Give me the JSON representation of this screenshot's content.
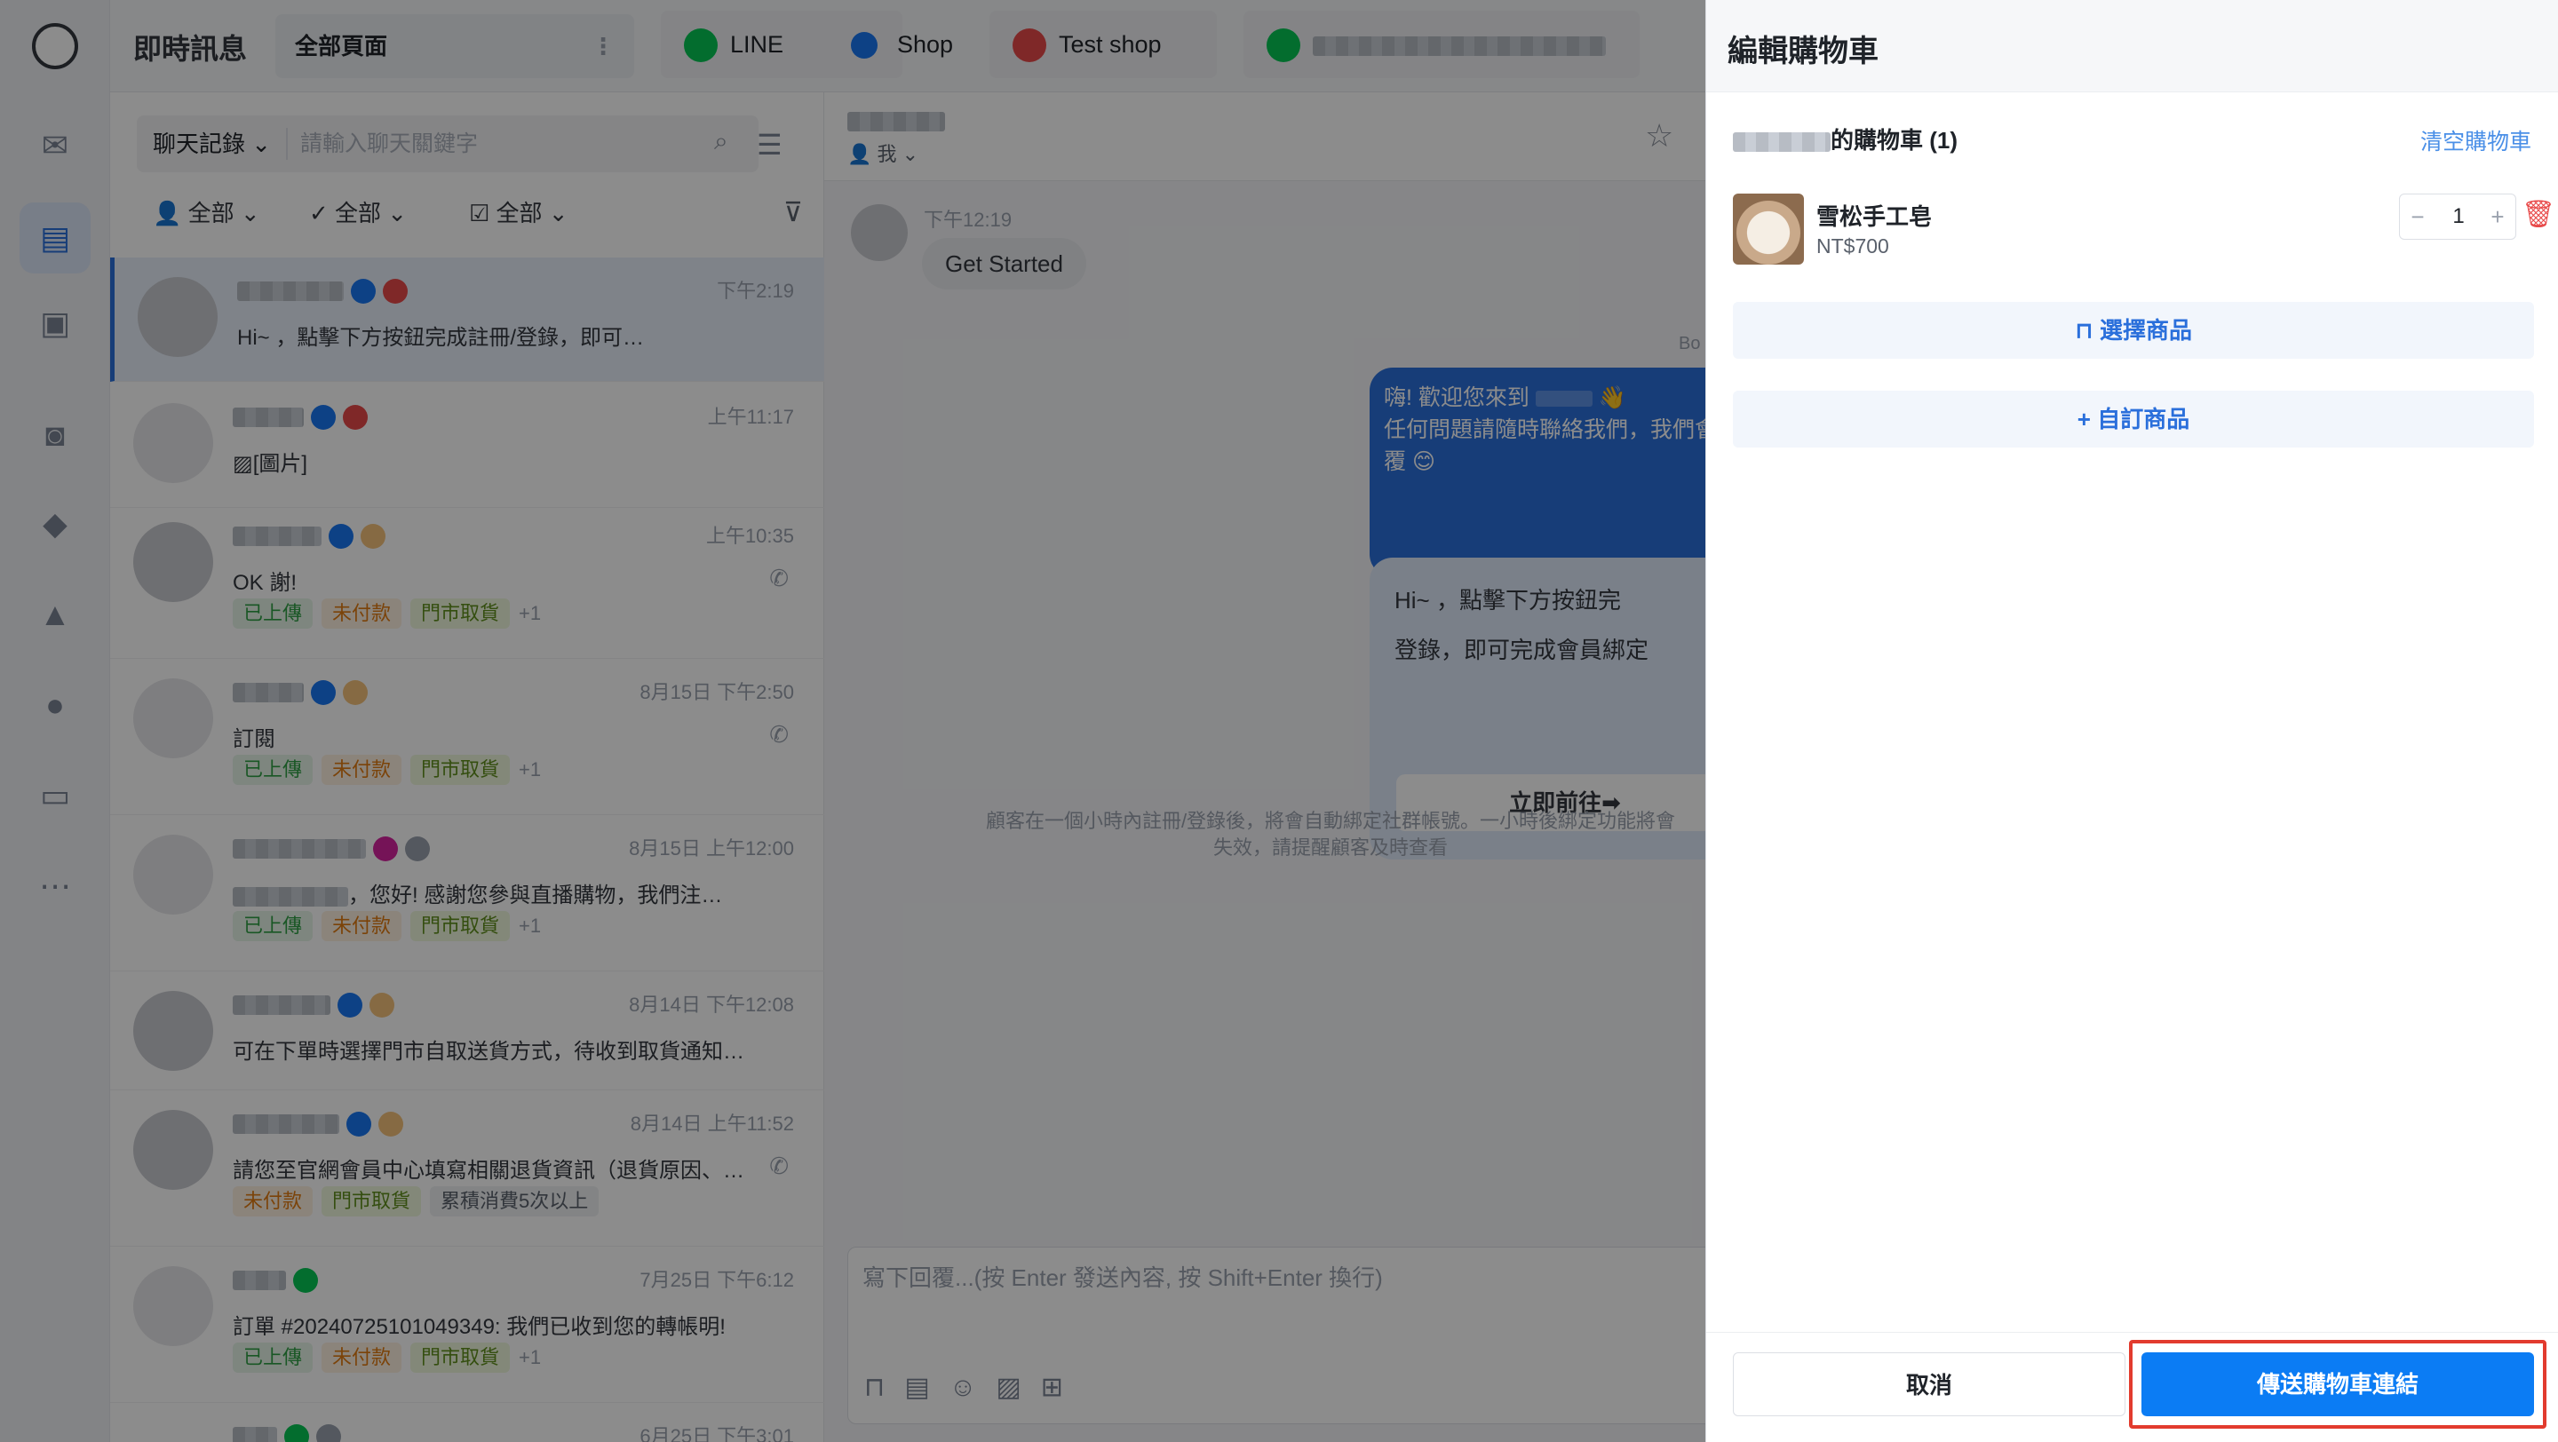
{
  "app": {
    "title": "即時訊息",
    "pages_label": "全部頁面"
  },
  "channels": [
    {
      "label": "LINE",
      "color": "#06c755",
      "icon": "line-icon"
    },
    {
      "label": "Shop",
      "color": "#1877f2",
      "icon": "shop-icon"
    },
    {
      "label": "Test shop",
      "color": "#e84a4a",
      "icon": "test-shop-icon"
    },
    {
      "label": "",
      "color": "#06c755",
      "icon": "whatsapp-icon"
    }
  ],
  "chatlist": {
    "scope_label": "聊天記錄",
    "search_placeholder": "請輸入聊天關鍵字",
    "filters": [
      "全部",
      "全部",
      "全部"
    ],
    "items": [
      {
        "time": "下午2:19",
        "preview": "Hi~        ，點擊下方按鈕完成註冊/登錄，即可…",
        "tags": []
      },
      {
        "time": "上午11:17",
        "preview": "[圖片]",
        "tags": []
      },
      {
        "time": "上午10:35",
        "preview": "OK 謝!",
        "tags": [
          "已上傳",
          "未付款",
          "門市取貨"
        ],
        "more": "+1"
      },
      {
        "time": "8月15日 下午2:50",
        "preview": "訂閱",
        "tags": [
          "已上傳",
          "未付款",
          "門市取貨"
        ],
        "more": "+1"
      },
      {
        "time": "8月15日 上午12:00",
        "preview": "，您好! 感謝您參與直播購物，我們注…",
        "tags": [
          "已上傳",
          "未付款",
          "門市取貨"
        ],
        "more": "+1"
      },
      {
        "time": "8月14日 下午12:08",
        "preview": "可在下單時選擇門市自取送貨方式，待收到取貨通知…",
        "tags": []
      },
      {
        "time": "8月14日 上午11:52",
        "preview": "請您至官網會員中心填寫相關退貨資訊（退貨原因、…",
        "tags": [
          "未付款",
          "門市取貨",
          "累積消費5次以上"
        ]
      },
      {
        "time": "7月25日 下午6:12",
        "preview": "訂單 #20240725101049349:  我們已收到您的轉帳明!",
        "tags": [
          "已上傳",
          "未付款",
          "門市取貨"
        ],
        "more": "+1"
      },
      {
        "time": "6月25日 下午3:01",
        "preview": "",
        "tags": []
      }
    ]
  },
  "conversation": {
    "me_label": "我",
    "msg_time": "下午12:19",
    "incoming": "Get Started",
    "bot_label": "Bo",
    "outgoing_lines": [
      "嗨! 歡迎您來到",
      "任何問題請隨時聯絡我們，我們會",
      "覆"
    ],
    "card_lines": [
      "Hi~        ，點擊下方按鈕完",
      "登錄，即可完成會員綁定"
    ],
    "card_button": "立即前往➡",
    "system_note": "顧客在一個小時內註冊/登錄後，將會自動綁定社群帳號。一小時後綁定功能將會失效，請提醒顧客及時查看",
    "composer_placeholder": "寫下回覆...(按 Enter 發送內容, 按 Shift+Enter 換行)"
  },
  "drawer": {
    "title": "編輯購物車",
    "cart_title": "的購物車 (1)",
    "clear_label": "清空購物車",
    "product": {
      "name": "雪松手工皂",
      "price": "NT$700",
      "qty": "1"
    },
    "select_products": "選擇商品",
    "custom_product": "自訂商品",
    "cancel": "取消",
    "send": "傳送購物車連結"
  }
}
